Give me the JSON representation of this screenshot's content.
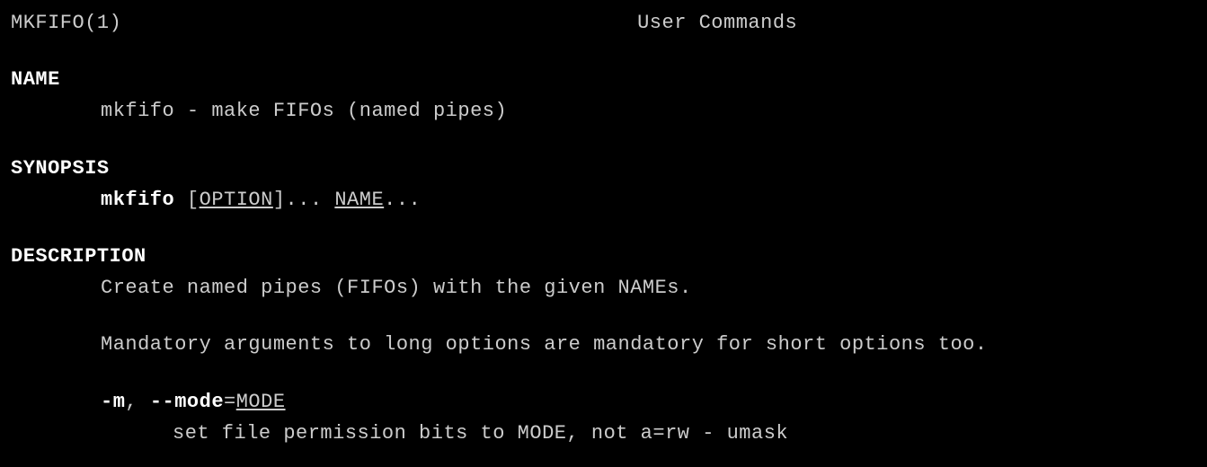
{
  "header": {
    "left": "MKFIFO(1)",
    "center": "User Commands"
  },
  "sections": {
    "name": {
      "heading": "NAME",
      "text": "mkfifo - make FIFOs (named pipes)"
    },
    "synopsis": {
      "heading": "SYNOPSIS",
      "command": "mkfifo",
      "bracket_open": " [",
      "option": "OPTION",
      "bracket_close": "]... ",
      "name_arg": "NAME",
      "trailing": "..."
    },
    "description": {
      "heading": "DESCRIPTION",
      "line1": "Create named pipes (FIFOs) with the given NAMEs.",
      "line2": "Mandatory arguments to long options are mandatory for short options too.",
      "opt_m_short": "-m",
      "opt_m_sep": ", ",
      "opt_m_long": "--mode",
      "opt_m_eq": "=",
      "opt_m_arg": "MODE",
      "opt_m_desc": "set file permission bits to MODE, not a=rw - umask"
    }
  }
}
